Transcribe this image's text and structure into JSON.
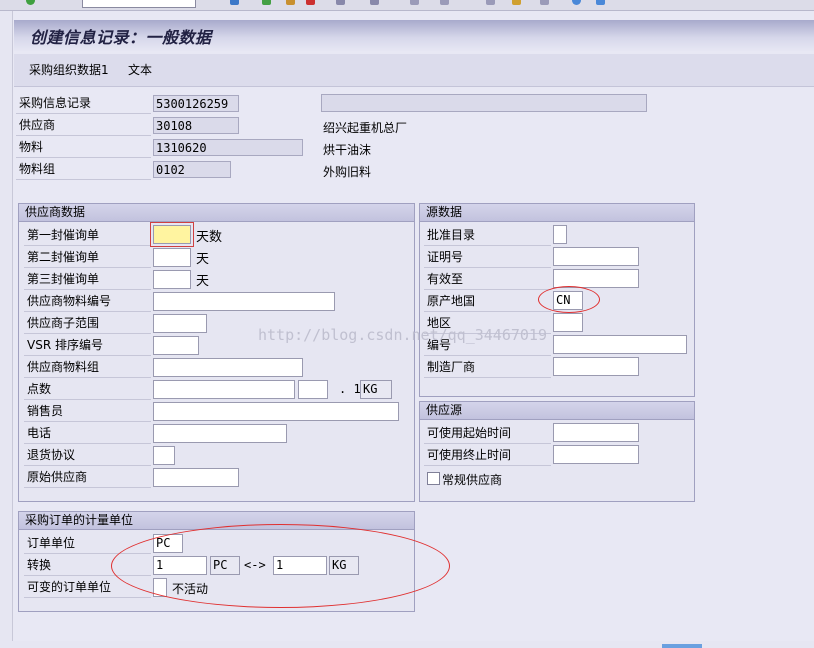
{
  "header": {
    "title": "创建信息记录：一般数据"
  },
  "menu": {
    "items": [
      "采购组织数据1",
      "文本"
    ]
  },
  "header_fields": {
    "info_record": {
      "label": "采购信息记录",
      "value": "5300126259"
    },
    "vendor": {
      "label": "供应商",
      "value": "30108",
      "desc": "绍兴起重机总厂"
    },
    "material": {
      "label": "物料",
      "value": "1310620",
      "desc": "烘干油沫"
    },
    "material_group": {
      "label": "物料组",
      "value": "0102",
      "desc": "外购旧料"
    }
  },
  "vendor_data": {
    "title": "供应商数据",
    "rows": [
      {
        "label": "第一封催询单",
        "value": "",
        "unit": "天数"
      },
      {
        "label": "第二封催询单",
        "value": "",
        "unit": "天"
      },
      {
        "label": "第三封催询单",
        "value": "",
        "unit": "天"
      },
      {
        "label": "供应商物料编号",
        "value": ""
      },
      {
        "label": "供应商子范围",
        "value": ""
      },
      {
        "label": "VSR 排序编号",
        "value": ""
      },
      {
        "label": "供应商物料组",
        "value": ""
      },
      {
        "label": "点数",
        "value": "",
        "value2": "",
        "sep": ". 1",
        "unit": "KG"
      },
      {
        "label": "销售员",
        "value": ""
      },
      {
        "label": "电话",
        "value": ""
      },
      {
        "label": "退货协议",
        "value": ""
      },
      {
        "label": "原始供应商",
        "value": ""
      }
    ]
  },
  "origin_data": {
    "title": "源数据",
    "rows": [
      {
        "label": "批准目录",
        "value": ""
      },
      {
        "label": "证明号",
        "value": ""
      },
      {
        "label": "有效至",
        "value": ""
      },
      {
        "label": "原产地国",
        "value": "CN"
      },
      {
        "label": "地区",
        "value": ""
      },
      {
        "label": "编号",
        "value": ""
      },
      {
        "label": "制造厂商",
        "value": ""
      }
    ]
  },
  "supply_source": {
    "title": "供应源",
    "rows": [
      {
        "label": "可使用起始时间",
        "value": ""
      },
      {
        "label": "可使用终止时间",
        "value": ""
      }
    ],
    "checkbox_label": "常规供应商"
  },
  "po_unit": {
    "title": "采购订单的计量单位",
    "order_unit_label": "订单单位",
    "order_unit": "PC",
    "conversion_label": "转换",
    "conv_qty1": "1",
    "conv_unit1": "PC",
    "conv_arrow": "<->",
    "conv_qty2": "1",
    "conv_unit2": "KG",
    "variable_label": "可变的订单单位",
    "variable_value": "",
    "inactive_label": "不活动"
  },
  "watermark": "http://blog.csdn.net/qq_34467019",
  "colors": {
    "annotation": "#e03030",
    "focus_field": "#fff4a0"
  }
}
